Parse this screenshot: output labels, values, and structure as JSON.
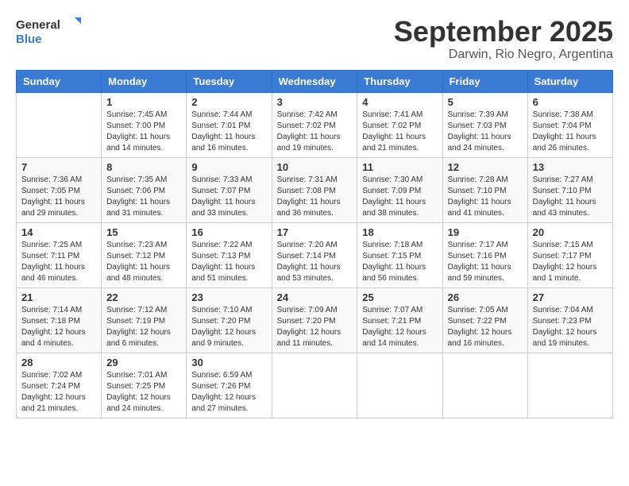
{
  "header": {
    "logo_general": "General",
    "logo_blue": "Blue",
    "month": "September 2025",
    "location": "Darwin, Rio Negro, Argentina"
  },
  "weekdays": [
    "Sunday",
    "Monday",
    "Tuesday",
    "Wednesday",
    "Thursday",
    "Friday",
    "Saturday"
  ],
  "weeks": [
    [
      {
        "day": "",
        "info": ""
      },
      {
        "day": "1",
        "info": "Sunrise: 7:45 AM\nSunset: 7:00 PM\nDaylight: 11 hours\nand 14 minutes."
      },
      {
        "day": "2",
        "info": "Sunrise: 7:44 AM\nSunset: 7:01 PM\nDaylight: 11 hours\nand 16 minutes."
      },
      {
        "day": "3",
        "info": "Sunrise: 7:42 AM\nSunset: 7:02 PM\nDaylight: 11 hours\nand 19 minutes."
      },
      {
        "day": "4",
        "info": "Sunrise: 7:41 AM\nSunset: 7:02 PM\nDaylight: 11 hours\nand 21 minutes."
      },
      {
        "day": "5",
        "info": "Sunrise: 7:39 AM\nSunset: 7:03 PM\nDaylight: 11 hours\nand 24 minutes."
      },
      {
        "day": "6",
        "info": "Sunrise: 7:38 AM\nSunset: 7:04 PM\nDaylight: 11 hours\nand 26 minutes."
      }
    ],
    [
      {
        "day": "7",
        "info": "Sunrise: 7:36 AM\nSunset: 7:05 PM\nDaylight: 11 hours\nand 29 minutes."
      },
      {
        "day": "8",
        "info": "Sunrise: 7:35 AM\nSunset: 7:06 PM\nDaylight: 11 hours\nand 31 minutes."
      },
      {
        "day": "9",
        "info": "Sunrise: 7:33 AM\nSunset: 7:07 PM\nDaylight: 11 hours\nand 33 minutes."
      },
      {
        "day": "10",
        "info": "Sunrise: 7:31 AM\nSunset: 7:08 PM\nDaylight: 11 hours\nand 36 minutes."
      },
      {
        "day": "11",
        "info": "Sunrise: 7:30 AM\nSunset: 7:09 PM\nDaylight: 11 hours\nand 38 minutes."
      },
      {
        "day": "12",
        "info": "Sunrise: 7:28 AM\nSunset: 7:10 PM\nDaylight: 11 hours\nand 41 minutes."
      },
      {
        "day": "13",
        "info": "Sunrise: 7:27 AM\nSunset: 7:10 PM\nDaylight: 11 hours\nand 43 minutes."
      }
    ],
    [
      {
        "day": "14",
        "info": "Sunrise: 7:25 AM\nSunset: 7:11 PM\nDaylight: 11 hours\nand 46 minutes."
      },
      {
        "day": "15",
        "info": "Sunrise: 7:23 AM\nSunset: 7:12 PM\nDaylight: 11 hours\nand 48 minutes."
      },
      {
        "day": "16",
        "info": "Sunrise: 7:22 AM\nSunset: 7:13 PM\nDaylight: 11 hours\nand 51 minutes."
      },
      {
        "day": "17",
        "info": "Sunrise: 7:20 AM\nSunset: 7:14 PM\nDaylight: 11 hours\nand 53 minutes."
      },
      {
        "day": "18",
        "info": "Sunrise: 7:18 AM\nSunset: 7:15 PM\nDaylight: 11 hours\nand 56 minutes."
      },
      {
        "day": "19",
        "info": "Sunrise: 7:17 AM\nSunset: 7:16 PM\nDaylight: 11 hours\nand 59 minutes."
      },
      {
        "day": "20",
        "info": "Sunrise: 7:15 AM\nSunset: 7:17 PM\nDaylight: 12 hours\nand 1 minute."
      }
    ],
    [
      {
        "day": "21",
        "info": "Sunrise: 7:14 AM\nSunset: 7:18 PM\nDaylight: 12 hours\nand 4 minutes."
      },
      {
        "day": "22",
        "info": "Sunrise: 7:12 AM\nSunset: 7:19 PM\nDaylight: 12 hours\nand 6 minutes."
      },
      {
        "day": "23",
        "info": "Sunrise: 7:10 AM\nSunset: 7:20 PM\nDaylight: 12 hours\nand 9 minutes."
      },
      {
        "day": "24",
        "info": "Sunrise: 7:09 AM\nSunset: 7:20 PM\nDaylight: 12 hours\nand 11 minutes."
      },
      {
        "day": "25",
        "info": "Sunrise: 7:07 AM\nSunset: 7:21 PM\nDaylight: 12 hours\nand 14 minutes."
      },
      {
        "day": "26",
        "info": "Sunrise: 7:05 AM\nSunset: 7:22 PM\nDaylight: 12 hours\nand 16 minutes."
      },
      {
        "day": "27",
        "info": "Sunrise: 7:04 AM\nSunset: 7:23 PM\nDaylight: 12 hours\nand 19 minutes."
      }
    ],
    [
      {
        "day": "28",
        "info": "Sunrise: 7:02 AM\nSunset: 7:24 PM\nDaylight: 12 hours\nand 21 minutes."
      },
      {
        "day": "29",
        "info": "Sunrise: 7:01 AM\nSunset: 7:25 PM\nDaylight: 12 hours\nand 24 minutes."
      },
      {
        "day": "30",
        "info": "Sunrise: 6:59 AM\nSunset: 7:26 PM\nDaylight: 12 hours\nand 27 minutes."
      },
      {
        "day": "",
        "info": ""
      },
      {
        "day": "",
        "info": ""
      },
      {
        "day": "",
        "info": ""
      },
      {
        "day": "",
        "info": ""
      }
    ]
  ]
}
